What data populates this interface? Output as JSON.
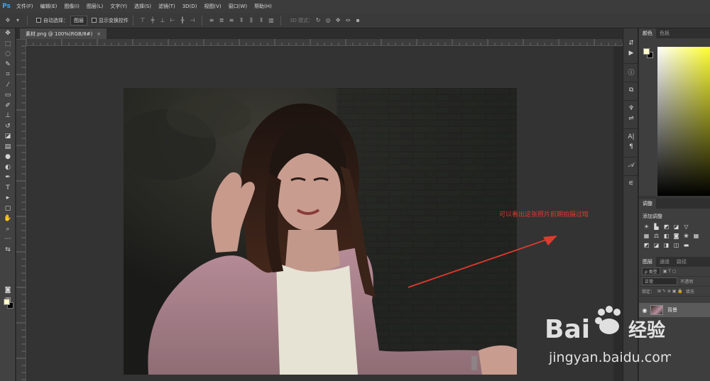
{
  "app": {
    "logo": "Ps"
  },
  "menu": [
    "文件(F)",
    "编辑(E)",
    "图像(I)",
    "图层(L)",
    "文字(Y)",
    "选择(S)",
    "滤镜(T)",
    "3D(D)",
    "视图(V)",
    "窗口(W)",
    "帮助(H)"
  ],
  "options": {
    "auto_select_label": "自动选择：",
    "auto_select_value": "图层",
    "show_transform_label": "显示变换控件",
    "mode_3d_label": "3D 模式："
  },
  "document": {
    "tab_title": "素材.png @ 100%(RGB/8#)",
    "tab_close": "×"
  },
  "annotation": {
    "text": "可以看出这张照片前期拍摄过暗",
    "color": "#e03a2e"
  },
  "panels": {
    "color_tabs": [
      "颜色",
      "色板"
    ],
    "adjust_tab": "调整",
    "adjust_title": "添加调整",
    "layer_tabs": [
      "图层",
      "通道",
      "路径"
    ],
    "layer_filter": "ρ 类型",
    "blend_mode": "正常",
    "opacity_label": "不透明",
    "lock_label": "锁定：",
    "fill_label": "填充",
    "layer_name": "背景"
  },
  "watermark": {
    "brand": "Bai",
    "brand2": "经验",
    "url": "jingyan.baidu.com"
  },
  "colors": {
    "foreground": "#fffcc8",
    "background": "#000000",
    "accent": "#31a8ff"
  }
}
